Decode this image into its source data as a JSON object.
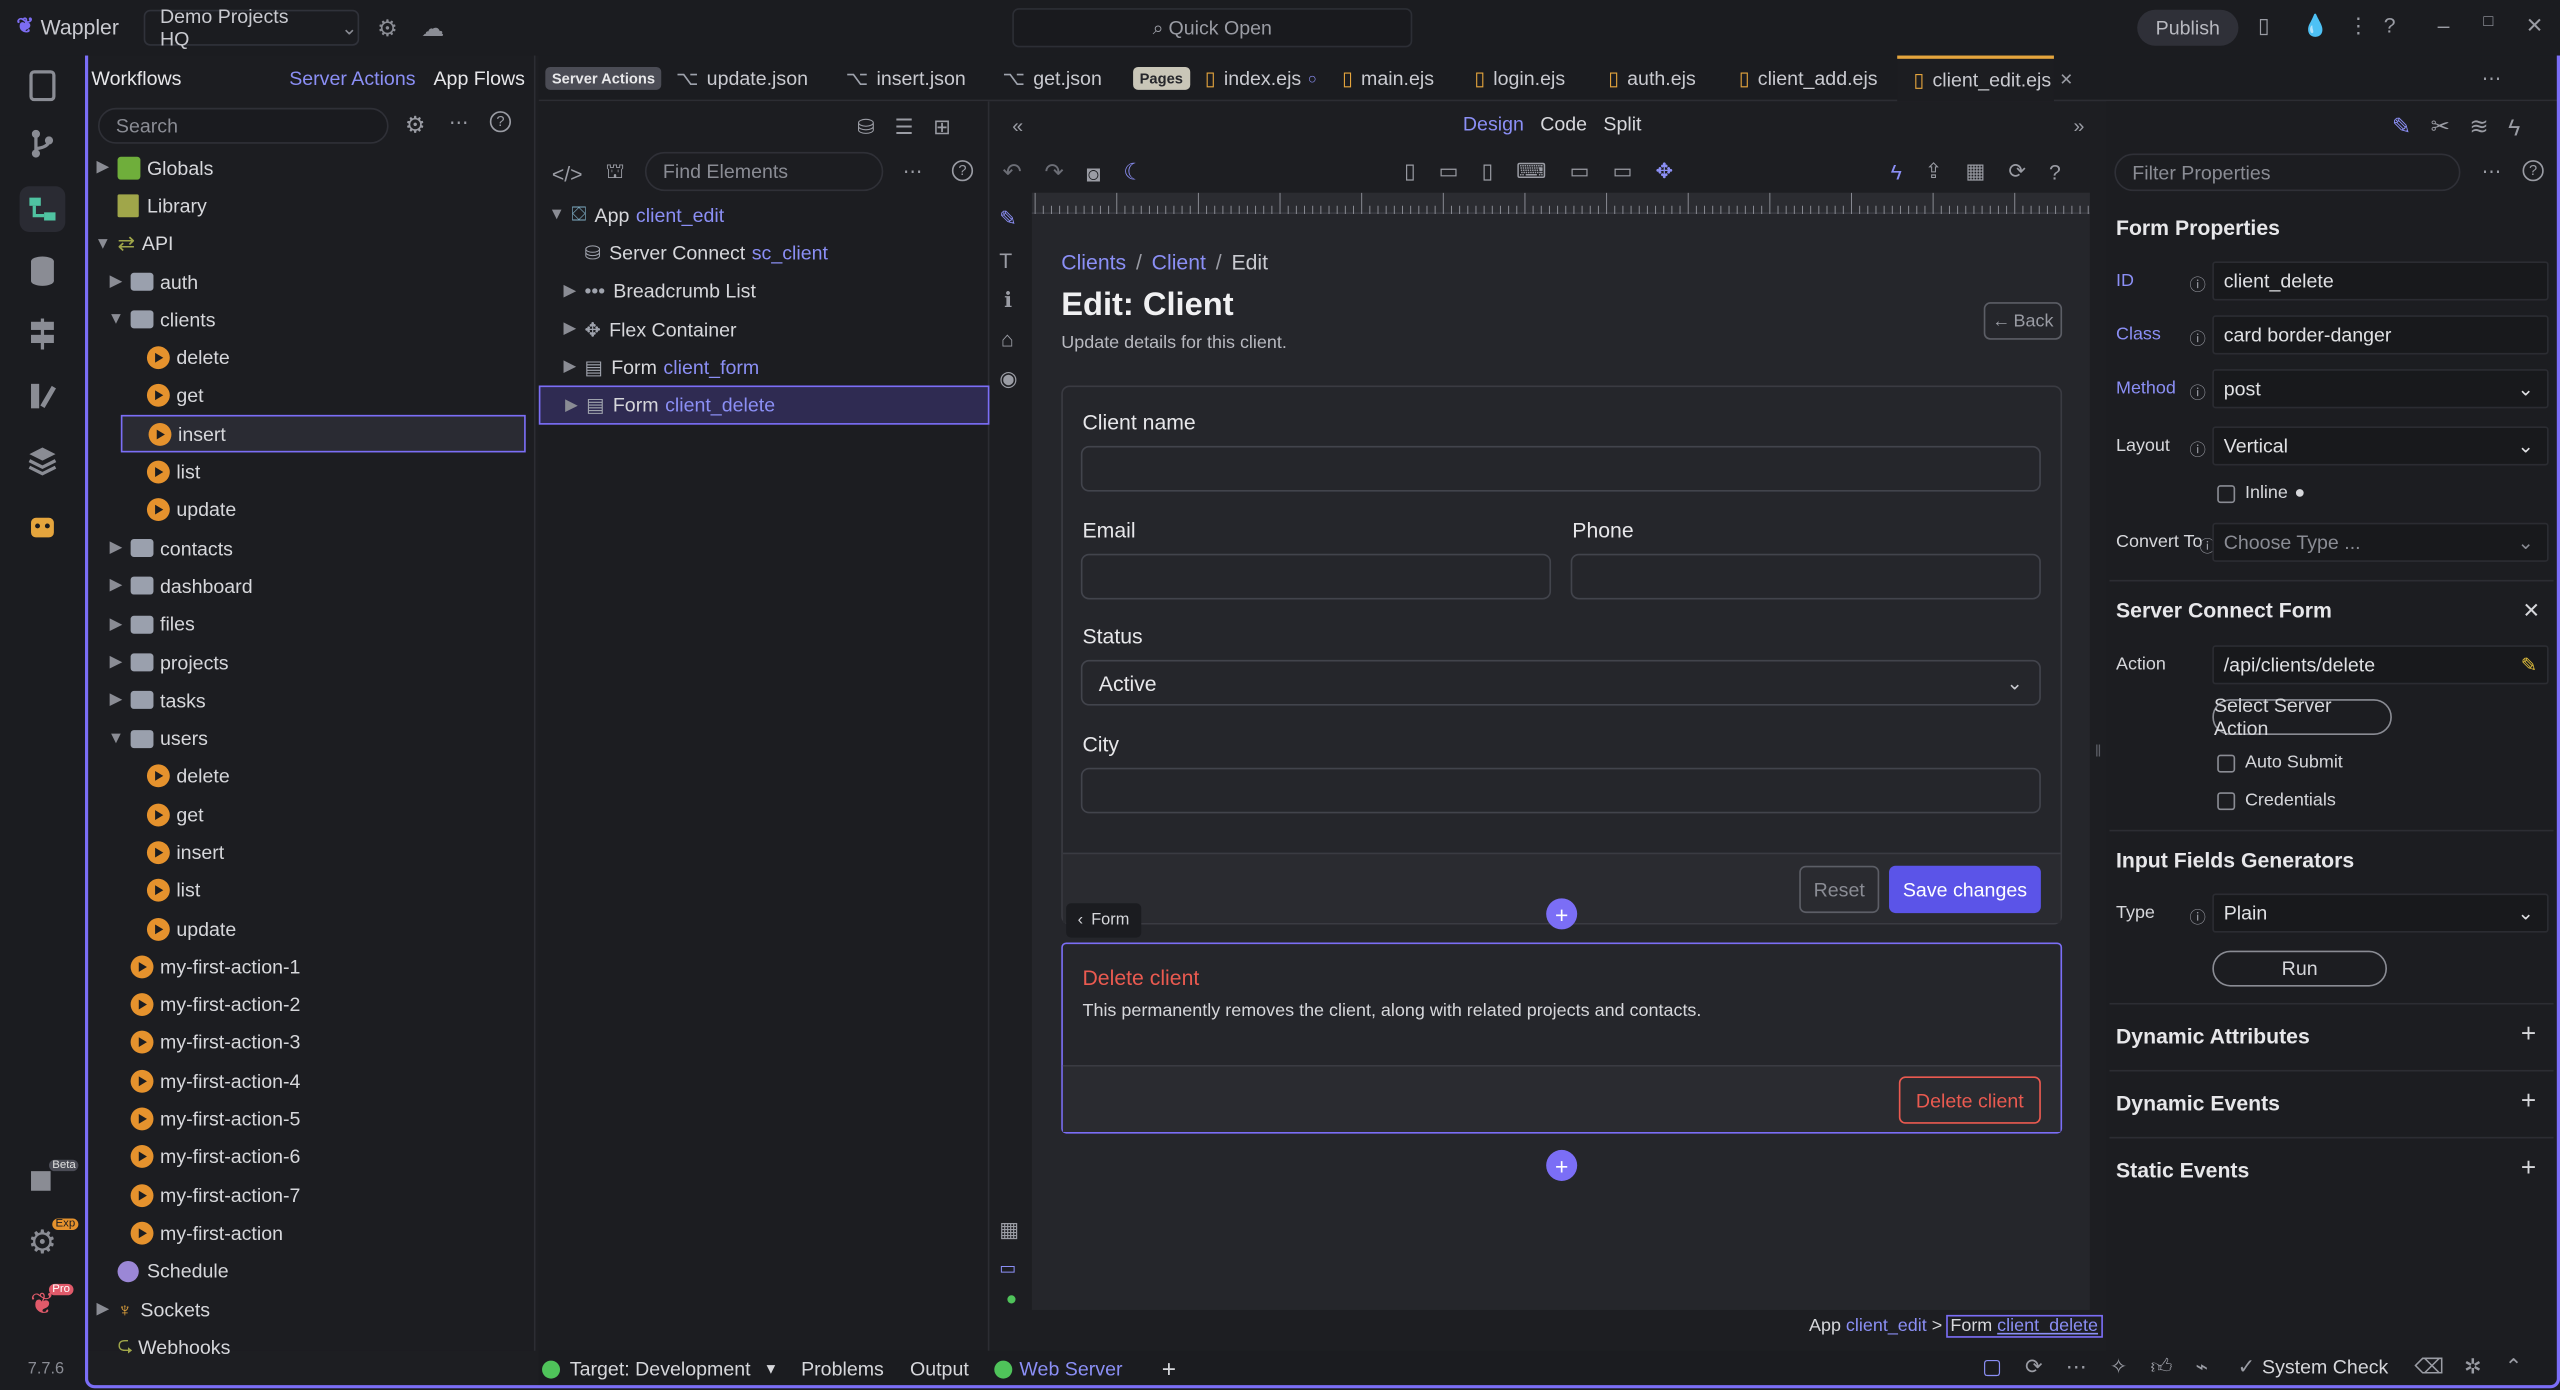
{
  "app": {
    "name": "Wappler",
    "project": "Demo Projects HQ",
    "version": "7.7.6"
  },
  "titlebar": {
    "quick_open": "Quick Open",
    "publish": "Publish"
  },
  "activity_badges": {
    "beta": "Beta",
    "exp": "Exp",
    "pro": "Pro"
  },
  "left": {
    "tabs": [
      "Workflows",
      "Server Actions",
      "App Flows"
    ],
    "search_placeholder": "Search",
    "tree": [
      {
        "label": "Globals",
        "kind": "globals",
        "depth": 0,
        "chev": "▶"
      },
      {
        "label": "Library",
        "kind": "library",
        "depth": 0,
        "chev": ""
      },
      {
        "label": "API",
        "kind": "api",
        "depth": 0,
        "chev": "▼"
      },
      {
        "label": "auth",
        "kind": "folder",
        "depth": 1,
        "chev": "▶"
      },
      {
        "label": "clients",
        "kind": "folder",
        "depth": 1,
        "chev": "▼"
      },
      {
        "label": "delete",
        "kind": "action",
        "depth": 2,
        "chev": ""
      },
      {
        "label": "get",
        "kind": "action",
        "depth": 2,
        "chev": ""
      },
      {
        "label": "insert",
        "kind": "action",
        "depth": 2,
        "chev": "",
        "selected": true
      },
      {
        "label": "list",
        "kind": "action",
        "depth": 2,
        "chev": ""
      },
      {
        "label": "update",
        "kind": "action",
        "depth": 2,
        "chev": ""
      },
      {
        "label": "contacts",
        "kind": "folder",
        "depth": 1,
        "chev": "▶"
      },
      {
        "label": "dashboard",
        "kind": "folder",
        "depth": 1,
        "chev": "▶"
      },
      {
        "label": "files",
        "kind": "folder",
        "depth": 1,
        "chev": "▶"
      },
      {
        "label": "projects",
        "kind": "folder",
        "depth": 1,
        "chev": "▶"
      },
      {
        "label": "tasks",
        "kind": "folder",
        "depth": 1,
        "chev": "▶"
      },
      {
        "label": "users",
        "kind": "folder",
        "depth": 1,
        "chev": "▼"
      },
      {
        "label": "delete",
        "kind": "action",
        "depth": 2,
        "chev": ""
      },
      {
        "label": "get",
        "kind": "action",
        "depth": 2,
        "chev": ""
      },
      {
        "label": "insert",
        "kind": "action",
        "depth": 2,
        "chev": ""
      },
      {
        "label": "list",
        "kind": "action",
        "depth": 2,
        "chev": ""
      },
      {
        "label": "update",
        "kind": "action",
        "depth": 2,
        "chev": ""
      },
      {
        "label": "my-first-action-1",
        "kind": "action",
        "depth": 1,
        "chev": ""
      },
      {
        "label": "my-first-action-2",
        "kind": "action",
        "depth": 1,
        "chev": ""
      },
      {
        "label": "my-first-action-3",
        "kind": "action",
        "depth": 1,
        "chev": ""
      },
      {
        "label": "my-first-action-4",
        "kind": "action",
        "depth": 1,
        "chev": ""
      },
      {
        "label": "my-first-action-5",
        "kind": "action",
        "depth": 1,
        "chev": ""
      },
      {
        "label": "my-first-action-6",
        "kind": "action",
        "depth": 1,
        "chev": ""
      },
      {
        "label": "my-first-action-7",
        "kind": "action",
        "depth": 1,
        "chev": ""
      },
      {
        "label": "my-first-action",
        "kind": "action",
        "depth": 1,
        "chev": ""
      },
      {
        "label": "Schedule",
        "kind": "schedule",
        "depth": 0,
        "chev": ""
      },
      {
        "label": "Sockets",
        "kind": "sockets",
        "depth": 0,
        "chev": "▶"
      },
      {
        "label": "Webhooks",
        "kind": "webhooks",
        "depth": 0,
        "chev": ""
      }
    ]
  },
  "doc_tabs": {
    "server_badge": "Server Actions",
    "pages_badge": "Pages",
    "tabs": [
      "update.json",
      "insert.json",
      "get.json",
      "index.ejs",
      "main.ejs",
      "login.ejs",
      "auth.ejs",
      "client_add.ejs",
      "client_edit.ejs"
    ]
  },
  "structure": {
    "find_placeholder": "Find Elements",
    "items": [
      {
        "type": "App",
        "name": "client_edit",
        "depth": 0,
        "chev": "▼"
      },
      {
        "type": "Server Connect",
        "name": "sc_client",
        "depth": 1,
        "chev": ""
      },
      {
        "type": "Breadcrumb List",
        "name": "",
        "depth": 1,
        "chev": "▶"
      },
      {
        "type": "Flex Container",
        "name": "",
        "depth": 1,
        "chev": "▶"
      },
      {
        "type": "Form",
        "name": "client_form",
        "depth": 1,
        "chev": "▶"
      },
      {
        "type": "Form",
        "name": "client_delete",
        "depth": 1,
        "chev": "▶",
        "selected": true
      }
    ]
  },
  "view_modes": {
    "design": "Design",
    "code": "Code",
    "split": "Split"
  },
  "page": {
    "breadcrumb": [
      "Clients",
      "Client",
      "Edit"
    ],
    "title": "Edit: Client",
    "subtitle": "Update details for this client.",
    "back": "Back",
    "form": {
      "client_name": "Client name",
      "email": "Email",
      "phone": "Phone",
      "status": "Status",
      "status_value": "Active",
      "city": "City",
      "reset": "Reset",
      "save": "Save changes"
    },
    "form_chip": "Form",
    "danger": {
      "title": "Delete client",
      "text": "This permanently removes the client, along with related projects and contacts.",
      "button": "Delete client"
    }
  },
  "props": {
    "filter_placeholder": "Filter Properties",
    "form_title": "Form Properties",
    "id_label": "ID",
    "id_value": "client_delete",
    "class_label": "Class",
    "class_value": "card border-danger",
    "method_label": "Method",
    "method_value": "post",
    "layout_label": "Layout",
    "layout_value": "Vertical",
    "inline": "Inline",
    "convert_label": "Convert To",
    "convert_placeholder": "Choose Type ...",
    "sc_title": "Server Connect Form",
    "action_label": "Action",
    "action_value": "/api/clients/delete",
    "select_action": "Select Server Action",
    "auto_submit": "Auto Submit",
    "credentials": "Credentials",
    "gen_title": "Input Fields Generators",
    "type_label": "Type",
    "type_value": "Plain",
    "run": "Run",
    "dyn_attr": "Dynamic Attributes",
    "dyn_events": "Dynamic Events",
    "static_events": "Static Events"
  },
  "breadcrumb_path": {
    "app": "App",
    "app_name": "client_edit",
    "form": "Form",
    "form_name": "client_delete"
  },
  "status": {
    "target": "Target: Development",
    "problems": "Problems",
    "output": "Output",
    "web_server": "Web Server",
    "system_check": "System Check"
  },
  "colors": {
    "accent": "#7b6ef6",
    "danger": "#ea5a50",
    "primary": "#5b54e8",
    "link": "#8b8ff5"
  }
}
